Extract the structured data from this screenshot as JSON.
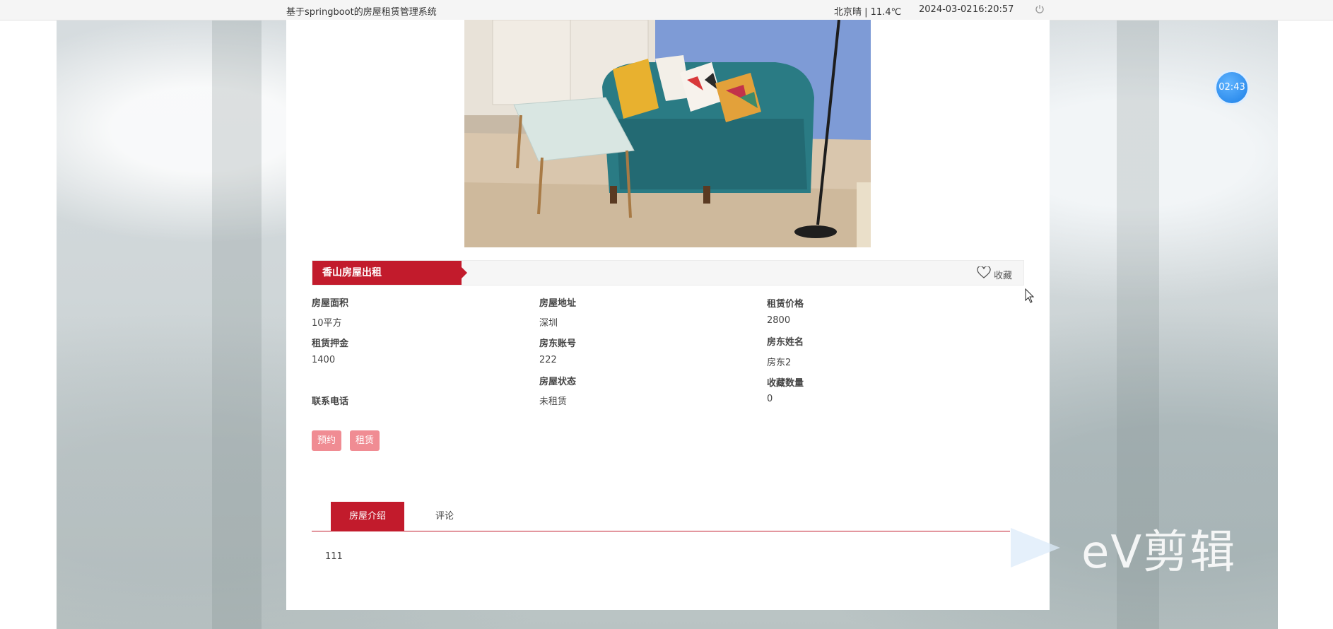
{
  "topbar": {
    "system_title": "基于springboot的房屋租赁管理系统",
    "weather": "北京晴 | 11.4℃",
    "date": "2024-03-02",
    "time": "16:20:57",
    "power_icon": "power-icon"
  },
  "listing": {
    "title": "香山房屋出租",
    "favorite_label": "收藏",
    "fields": [
      {
        "label": "房屋面积",
        "value": "10平方"
      },
      {
        "label": "房屋地址",
        "value": "深圳"
      },
      {
        "label": "租赁价格",
        "value": "2800"
      },
      {
        "label": "租赁押金",
        "value": "1400"
      },
      {
        "label": "房东账号",
        "value": "222"
      },
      {
        "label": "房东姓名",
        "value": "房东2"
      },
      {
        "label": "联系电话",
        "value": ""
      },
      {
        "label": "房屋状态",
        "value": "未租赁"
      },
      {
        "label": "收藏数量",
        "value": "0"
      }
    ],
    "buttons": {
      "reserve": "预约",
      "rent": "租赁"
    }
  },
  "tabs": [
    {
      "label": "房屋介绍",
      "active": true
    },
    {
      "label": "评论",
      "active": false
    }
  ],
  "intro_text": "111",
  "overlay": {
    "timer": "02:43",
    "watermark": "eV剪辑"
  },
  "colors": {
    "accent": "#c21b2c",
    "button": "#f08c93"
  }
}
